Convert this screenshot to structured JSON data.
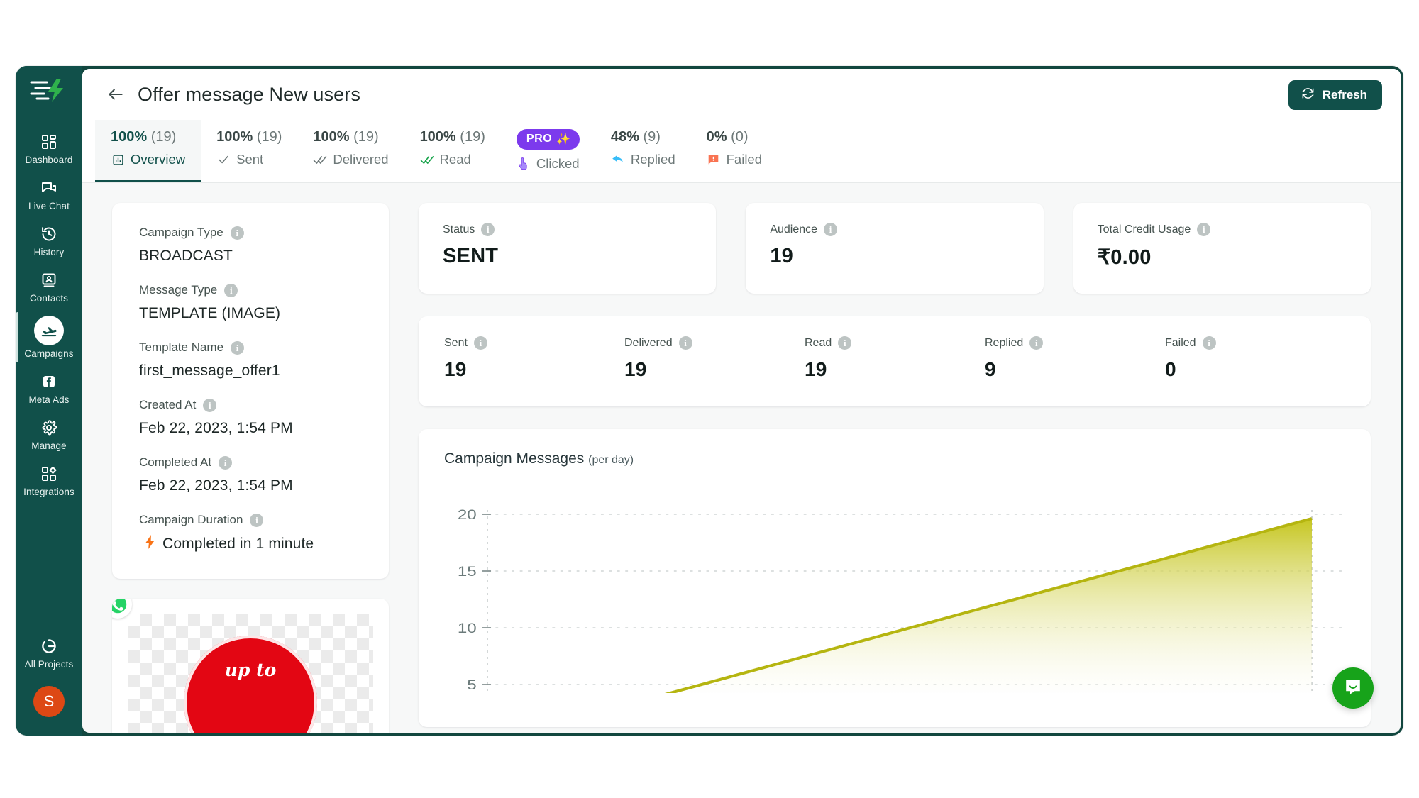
{
  "sidebar": {
    "logo_name": "wati-logo",
    "items": [
      {
        "label": "Dashboard",
        "icon": "grid-icon",
        "active": false
      },
      {
        "label": "Live Chat",
        "icon": "chat-bubbles-icon",
        "active": false
      },
      {
        "label": "History",
        "icon": "history-clock-icon",
        "active": false
      },
      {
        "label": "Contacts",
        "icon": "contact-card-icon",
        "active": false
      },
      {
        "label": "Campaigns",
        "icon": "plane-takeoff-icon",
        "active": true
      },
      {
        "label": "Meta Ads",
        "icon": "facebook-icon",
        "active": false
      },
      {
        "label": "Manage",
        "icon": "gear-icon",
        "active": false
      },
      {
        "label": "Integrations",
        "icon": "integrations-icon",
        "active": false
      },
      {
        "label": "All Projects",
        "icon": "projects-ring-icon",
        "active": false
      }
    ],
    "avatar_initial": "S",
    "avatar_color": "#dd4814"
  },
  "header": {
    "back_icon": "arrow-left-icon",
    "title": "Offer message New users",
    "refresh_label": "Refresh",
    "refresh_icon": "refresh-icon"
  },
  "tabs": [
    {
      "percent": "100%",
      "count": "(19)",
      "label": "Overview",
      "icon": "chart-bar-icon",
      "active": true,
      "pro": false
    },
    {
      "percent": "100%",
      "count": "(19)",
      "label": "Sent",
      "icon": "check-icon",
      "active": false,
      "pro": false
    },
    {
      "percent": "100%",
      "count": "(19)",
      "label": "Delivered",
      "icon": "double-check-icon",
      "active": false,
      "pro": false
    },
    {
      "percent": "100%",
      "count": "(19)",
      "label": "Read",
      "icon": "double-check-blue-icon",
      "active": false,
      "pro": false
    },
    {
      "percent": "PRO",
      "count": "",
      "label": "Clicked",
      "icon": "pointer-icon",
      "active": false,
      "pro": true,
      "badge_label": "PRO",
      "badge_icon": "sparkles-icon"
    },
    {
      "percent": "48%",
      "count": "(9)",
      "label": "Replied",
      "icon": "reply-arrow-icon",
      "active": false,
      "pro": false
    },
    {
      "percent": "0%",
      "count": "(0)",
      "label": "Failed",
      "icon": "failed-icon",
      "active": false,
      "pro": false
    }
  ],
  "info_card": {
    "rows": [
      {
        "label": "Campaign Type",
        "value": "BROADCAST"
      },
      {
        "label": "Message Type",
        "value": "TEMPLATE (IMAGE)"
      },
      {
        "label": "Template Name",
        "value": "first_message_offer1"
      },
      {
        "label": "Created At",
        "value": "Feb 22, 2023, 1:54 PM"
      },
      {
        "label": "Completed At",
        "value": "Feb 22, 2023, 1:54 PM"
      },
      {
        "label": "Campaign Duration",
        "value": "Completed in 1 minute"
      }
    ],
    "duration_icon": "lightning-bolt-icon",
    "info_glyph": "i"
  },
  "preview": {
    "whatsapp_icon": "whatsapp-icon",
    "offer_text": "up to"
  },
  "stat_cards": [
    {
      "label": "Status",
      "value": "SENT"
    },
    {
      "label": "Audience",
      "value": "19"
    },
    {
      "label": "Total Credit Usage",
      "value": "₹0.00"
    }
  ],
  "metrics": [
    {
      "label": "Sent",
      "value": "19"
    },
    {
      "label": "Delivered",
      "value": "19"
    },
    {
      "label": "Read",
      "value": "19"
    },
    {
      "label": "Replied",
      "value": "9"
    },
    {
      "label": "Failed",
      "value": "0"
    }
  ],
  "chart_card": {
    "title": "Campaign Messages",
    "subtitle": "(per day)"
  },
  "chart_data": {
    "type": "area",
    "title": "Campaign Messages (per day)",
    "xlabel": "",
    "ylabel": "",
    "ylim": [
      5,
      20
    ],
    "yticks": [
      5,
      10,
      15,
      20
    ],
    "grid": true,
    "legend": "none",
    "line_color": "#b5b510",
    "fill_gradient": [
      "#c3c315",
      "#ffffff"
    ],
    "x": [
      0,
      1
    ],
    "series": [
      {
        "name": "Messages",
        "values": [
          4.2,
          19.5
        ]
      }
    ]
  },
  "chat_widget": {
    "icon": "intercom-chat-icon",
    "color": "#17a31a"
  },
  "colors": {
    "brand_dark": "#11504a",
    "page_bg": "#f7f8f8",
    "pro_purple": "#7c3aed",
    "accent_orange": "#dd4814"
  }
}
